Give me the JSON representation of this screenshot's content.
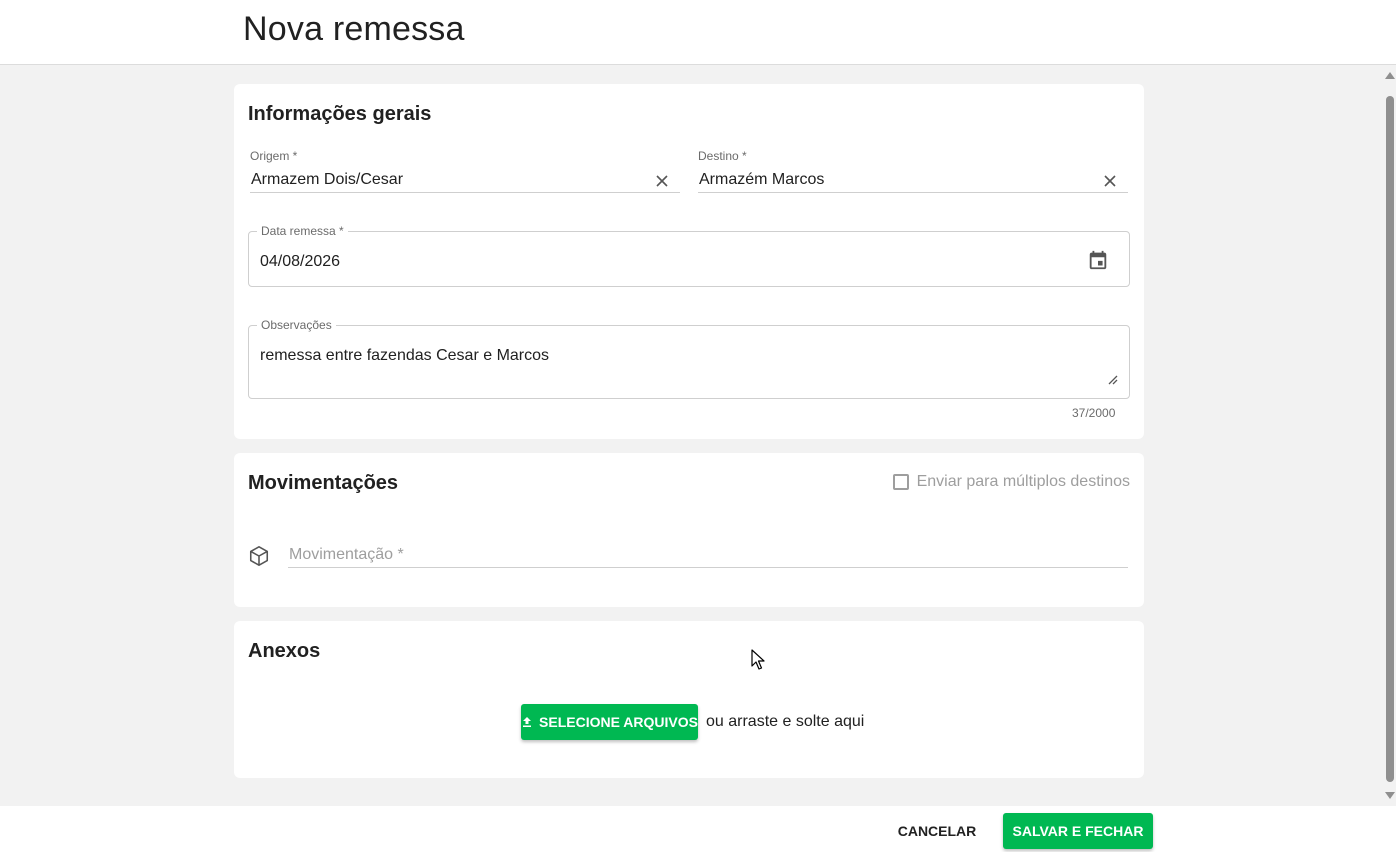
{
  "header": {
    "title": "Nova remessa"
  },
  "general": {
    "title": "Informações gerais",
    "origem": {
      "label": "Origem *",
      "value": "Armazem Dois/Cesar"
    },
    "destino": {
      "label": "Destino *",
      "value": "Armazém Marcos"
    },
    "data_remessa": {
      "label": "Data remessa *",
      "value": "04/08/2026"
    },
    "observacoes": {
      "label": "Observações",
      "value": "remessa entre fazendas Cesar e Marcos",
      "counter": "37/2000"
    }
  },
  "movimentacoes": {
    "title": "Movimentações",
    "multi_dest_label": "Enviar para múltiplos destinos",
    "field_placeholder": "Movimentação *"
  },
  "anexos": {
    "title": "Anexos",
    "upload_label": "SELECIONE ARQUIVOS",
    "drop_text": "ou arraste e solte aqui"
  },
  "footer": {
    "cancel_label": "CANCELAR",
    "save_label": "SALVAR E FECHAR"
  },
  "colors": {
    "accent": "#00b852",
    "text": "#212121",
    "muted": "#6b6b6b",
    "background": "#f2f2f2"
  }
}
